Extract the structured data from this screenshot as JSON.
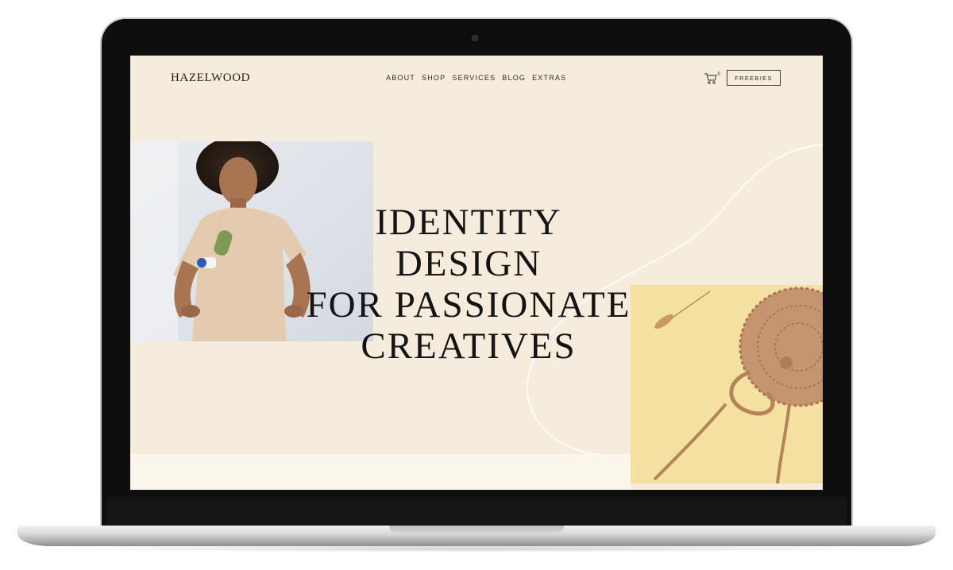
{
  "site": {
    "logo": "HAZELWOOD",
    "nav": [
      "ABOUT",
      "SHOP",
      "SERVICES",
      "BLOG",
      "EXTRAS"
    ],
    "cta": "FREEBIES",
    "cart_count": "0"
  },
  "hero": {
    "lines": [
      "IDENTITY DESIGN",
      "FOR PASSIONATE",
      "CREATIVES"
    ]
  },
  "icons": {
    "cart": "shopping-cart-icon"
  },
  "colors": {
    "background": "#f5ecdd",
    "text": "#141414",
    "accent_yellow": "#f3dd9c",
    "bezel": "#0e0e0e"
  }
}
